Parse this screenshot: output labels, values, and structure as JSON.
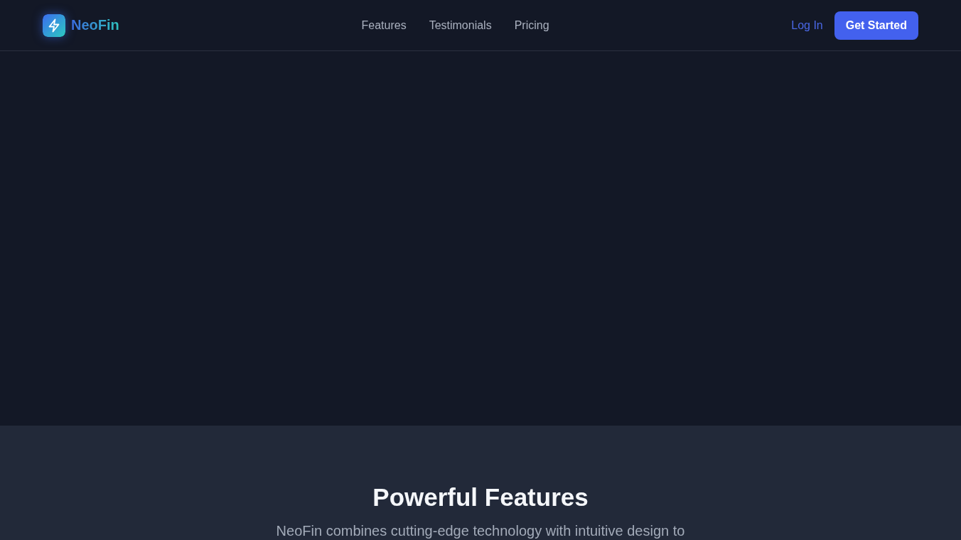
{
  "header": {
    "brand": "NeoFin",
    "nav": [
      "Features",
      "Testimonials",
      "Pricing"
    ],
    "login": "Log In",
    "cta": "Get Started"
  },
  "features_section": {
    "title": "Powerful Features",
    "subtitle": "NeoFin combines cutting-edge technology with intuitive design to"
  }
}
